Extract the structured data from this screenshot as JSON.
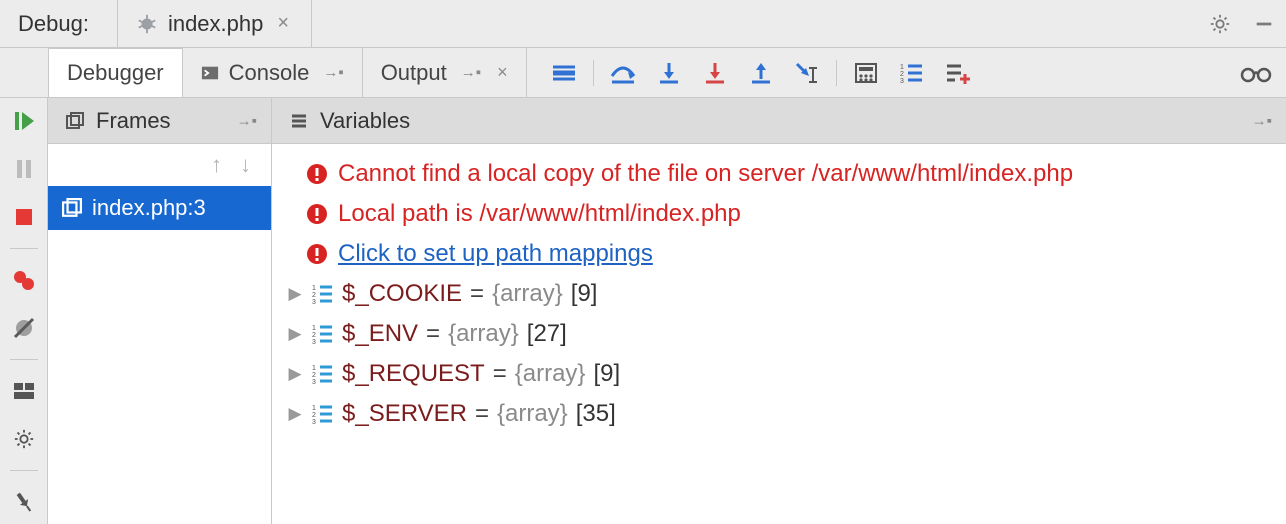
{
  "header": {
    "title": "Debug:",
    "file_tab": {
      "label": "index.php"
    }
  },
  "tabs": {
    "debugger": "Debugger",
    "console": "Console",
    "output": "Output"
  },
  "panels": {
    "frames": {
      "title": "Frames"
    },
    "variables": {
      "title": "Variables"
    }
  },
  "frames": [
    {
      "label": "index.php:3"
    }
  ],
  "errors": [
    "Cannot find a local copy of the file on server /var/www/html/index.php",
    "Local path is /var/www/html/index.php"
  ],
  "error_link": "Click to set up path mappings",
  "variables": [
    {
      "name": "$_COOKIE",
      "type": "{array}",
      "count": "[9]"
    },
    {
      "name": "$_ENV",
      "type": "{array}",
      "count": "[27]"
    },
    {
      "name": "$_REQUEST",
      "type": "{array}",
      "count": "[9]"
    },
    {
      "name": "$_SERVER",
      "type": "{array}",
      "count": "[35]"
    }
  ]
}
